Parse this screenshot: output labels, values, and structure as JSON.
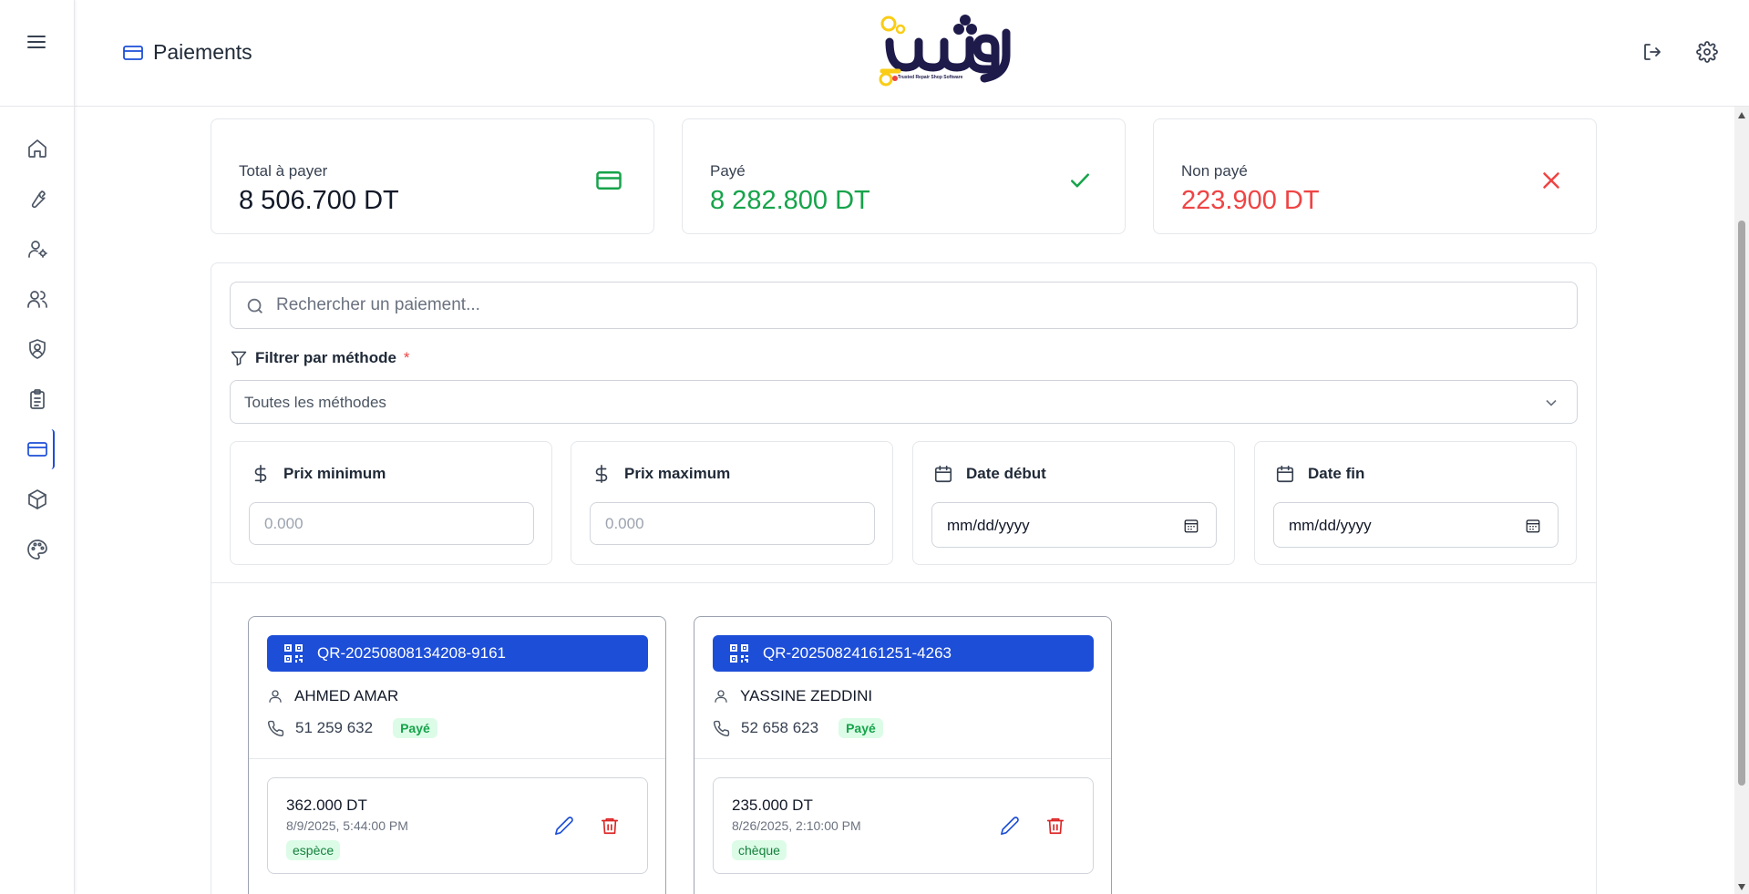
{
  "header": {
    "page_title": "Paiements",
    "logo_text": "ورشة",
    "logo_tagline": "Trusted Repair Shop Software",
    "icons": [
      "logout-icon",
      "settings-icon"
    ]
  },
  "sidebar": {
    "items": [
      {
        "name": "home-icon"
      },
      {
        "name": "wrench-icon"
      },
      {
        "name": "user-cog-icon"
      },
      {
        "name": "users-icon"
      },
      {
        "name": "shield-user-icon"
      },
      {
        "name": "clipboard-icon"
      },
      {
        "name": "credit-card-icon",
        "active": true
      },
      {
        "name": "package-icon"
      },
      {
        "name": "palette-icon"
      }
    ]
  },
  "stats": {
    "total": {
      "label": "Total à payer",
      "value": "8 506.700 DT",
      "color": "#111827"
    },
    "paid": {
      "label": "Payé",
      "value": "8 282.800 DT",
      "color": "#16a34a"
    },
    "unpaid": {
      "label": "Non payé",
      "value": "223.900 DT",
      "color": "#ef4444"
    }
  },
  "search": {
    "placeholder": "Rechercher un paiement...",
    "value": ""
  },
  "filter": {
    "label": "Filtrer par méthode",
    "required_mark": "*",
    "selected": "Toutes les méthodes"
  },
  "range_filters": {
    "min_price": {
      "label": "Prix minimum",
      "placeholder": "0.000"
    },
    "max_price": {
      "label": "Prix maximum",
      "placeholder": "0.000"
    },
    "start_date": {
      "label": "Date début",
      "value": "mm/dd/yyyy"
    },
    "end_date": {
      "label": "Date fin",
      "value": "mm/dd/yyyy"
    }
  },
  "payments": [
    {
      "qr": "QR-20250808134208-9161",
      "client": "AHMED AMAR",
      "phone": "51 259 632",
      "status": "Payé",
      "entry": {
        "amount": "362.000 DT",
        "date": "8/9/2025, 5:44:00 PM",
        "method": "espèce"
      }
    },
    {
      "qr": "QR-20250824161251-4263",
      "client": "YASSINE ZEDDINI",
      "phone": "52 658 623",
      "status": "Payé",
      "entry": {
        "amount": "235.000 DT",
        "date": "8/26/2025, 2:10:00 PM",
        "method": "chèque"
      }
    }
  ],
  "colors": {
    "accent": "#1d4ed8",
    "success": "#16a34a",
    "danger": "#ef4444",
    "logo_dark": "#1e1b4b",
    "logo_yellow": "#facc15"
  }
}
